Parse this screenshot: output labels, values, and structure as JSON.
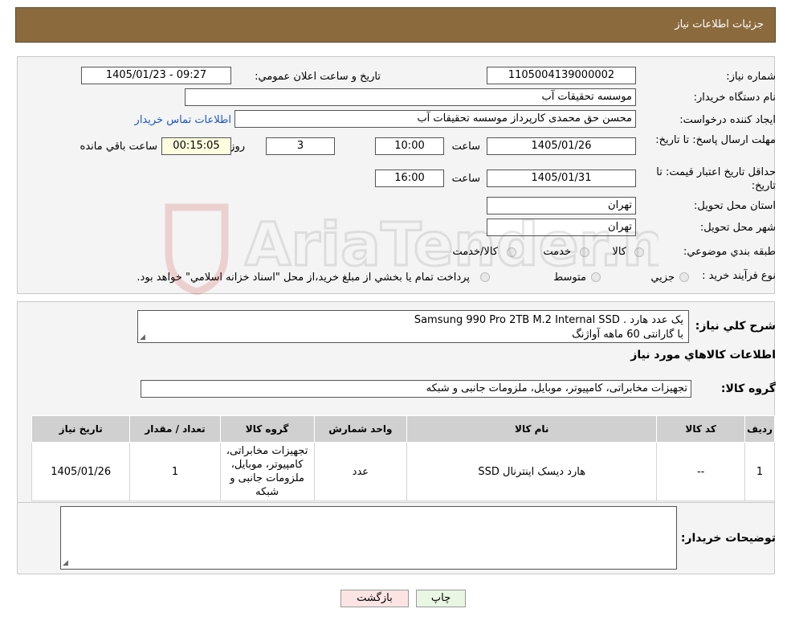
{
  "header": {
    "title": "جزئیات اطلاعات نیاز"
  },
  "form": {
    "need_number_label": "شماره نیاز:",
    "need_number": "1105004139000002",
    "announce_label": "تاریخ و ساعت اعلان عمومي:",
    "announce_value": "1405/01/23 - 09:27",
    "buyer_org_label": "نام دستگاه خريدار:",
    "buyer_org": "موسسه تحقیقات آب",
    "creator_label": "ايجاد کننده درخواست:",
    "creator": "محسن حق محمدی کارپرداز موسسه تحقیقات آب",
    "contact_link": "اطلاعات تماس خريدار",
    "deadline_label": "مهلت ارسال پاسخ: تا تاريخ:",
    "deadline_date": "1405/01/26",
    "time_label": "ساعت",
    "deadline_time": "10:00",
    "days_value": "3",
    "days_label": "روز و",
    "remaining_value": "00:15:05",
    "remaining_label": "ساعت باقي مانده",
    "validity_label": "حداقل تاريخ اعتبار قيمت: تا تاريخ:",
    "validity_date": "1405/01/31",
    "validity_time": "16:00",
    "province_label": "استان محل تحويل:",
    "province": "تهران",
    "city_label": "شهر محل تحويل:",
    "city": "تهران",
    "category_label": "طبقه بندي موضوعي:",
    "category_options": [
      "کالا",
      "خدمت",
      "کالا/خدمت"
    ],
    "process_label": "نوع فرآيند خريد :",
    "process_options": [
      "جزيي",
      "متوسط"
    ],
    "process_note": "پرداخت تمام يا بخشي از مبلغ خريد،از محل \"اسناد خزانه اسلامي\" خواهد بود."
  },
  "description": {
    "label": "شرح کلي نياز:",
    "line1": "یک عدد هارد .   Samsung 990 Pro 2TB M.2 Internal SSD",
    "line2": "با گارانتی 60 ماهه آواژنگ"
  },
  "goods": {
    "section_title": "اطلاعات کالاهاي مورد نياز",
    "group_label": "گروه کالا:",
    "group_value": "تجهیزات مخابراتی، کامپیوتر، موبایل، ملزومات جانبی و شبکه",
    "columns": [
      "رديف",
      "کد کالا",
      "نام کالا",
      "واحد شمارش",
      "گروه کالا",
      "تعداد / مقدار",
      "تاريخ نياز"
    ],
    "rows": [
      {
        "row": "1",
        "code": "--",
        "name": "هارد دیسک اینترنال SSD",
        "unit": "عدد",
        "group": "تجهیزات مخابراتی، کامپیوتر، موبایل، ملزومات جانبی و شبکه",
        "qty": "1",
        "date": "1405/01/26"
      }
    ]
  },
  "buyer_notes": {
    "label": "توضيحات خريدار:",
    "value": ""
  },
  "buttons": {
    "print": "چاپ",
    "back": "بازگشت"
  },
  "watermark": {
    "text": "AriaTender.neT"
  }
}
